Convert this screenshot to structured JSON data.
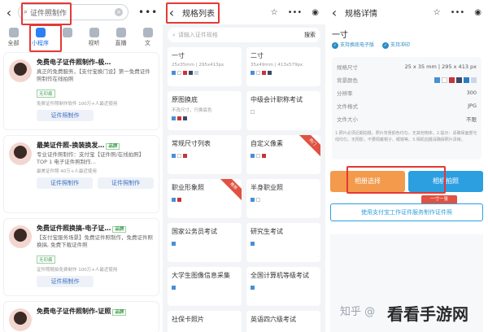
{
  "panel1": {
    "search_value": "证件照制作",
    "more_icon": "more-dots-icon",
    "tabs": [
      {
        "label": "全部",
        "active": false
      },
      {
        "label": "小程序",
        "active": true
      },
      {
        "label": "",
        "active": false
      },
      {
        "label": "视听",
        "active": false
      },
      {
        "label": "直播",
        "active": false
      },
      {
        "label": "文",
        "active": false
      }
    ],
    "results": [
      {
        "title": "免费电子证件照制作-极…",
        "desc": "真正的免费服务，【支付宝换门设】第一免费证件照制作在线拍照",
        "tag": "无印痕",
        "meta": "免费证件照制作软件  100万+人最近使用",
        "btn1": "证件照制作",
        "btn2": ""
      },
      {
        "title": "最美证件照-换装换发…",
        "badge": "品牌",
        "desc": "专业证件照制作：支付宝【证件照/在线拍照】TOP 1 电子证件照制作...",
        "tag": "",
        "meta": "最美证件照  40万+人最近使用",
        "btn1": "证件照制作",
        "btn2": "证件照制作"
      },
      {
        "title": "免费证件照换搞-电子证…",
        "badge": "品牌",
        "desc": "【支付宝服务场景】免费证件照制作，免费证件照换搞, 免费下载证件照",
        "tag": "无印痕",
        "meta": "证件照随拍免费制作  100万+人最近使用",
        "btn1": "证件照制作",
        "btn2": ""
      },
      {
        "title": "免费电子证件照制作-证照",
        "badge": "品牌",
        "desc": "",
        "tag": "",
        "meta": "",
        "btn1": "",
        "btn2": ""
      }
    ]
  },
  "panel2": {
    "title": "规格列表",
    "search_placeholder": "请输入证件规格",
    "search_button": "搜索",
    "specs": [
      {
        "name": "一寸",
        "size": "25x35mm | 295x413px",
        "ribbon": ""
      },
      {
        "name": "二寸",
        "size": "35x49mm | 413x579px",
        "ribbon": ""
      },
      {
        "name": "原图换底",
        "size": "不改尺寸，只换底色",
        "ribbon": ""
      },
      {
        "name": "中级会计职称考试",
        "size": "",
        "ribbon": ""
      },
      {
        "name": "常规尺寸列表",
        "size": "",
        "ribbon": ""
      },
      {
        "name": "自定义像素",
        "size": "",
        "ribbon": "热门"
      },
      {
        "name": "职业形象照",
        "size": "",
        "ribbon": "推荐"
      },
      {
        "name": "半身职业照",
        "size": "",
        "ribbon": ""
      },
      {
        "name": "国家公务员考试",
        "size": "",
        "ribbon": ""
      },
      {
        "name": "研究生考试",
        "size": "",
        "ribbon": ""
      },
      {
        "name": "大学生图像信息采集",
        "size": "",
        "ribbon": ""
      },
      {
        "name": "全国计算机等级考试",
        "size": "",
        "ribbon": ""
      },
      {
        "name": "社保卡照片",
        "size": "",
        "ribbon": ""
      },
      {
        "name": "英语四六级考试",
        "size": "",
        "ribbon": ""
      }
    ]
  },
  "panel3": {
    "title": "规格详情",
    "size_name": "一寸",
    "checks": [
      "支持换底电子版",
      "支持冲印"
    ],
    "rows": [
      {
        "k": "规格尺寸",
        "v": "25 x 35 mm | 295 x 413 px"
      },
      {
        "k": "背景颜色",
        "v": ""
      },
      {
        "k": "分辨率",
        "v": "300"
      },
      {
        "k": "文件格式",
        "v": "JPG"
      },
      {
        "k": "文件大小",
        "v": "不限"
      }
    ],
    "note": "1.照片必须近期拍摄，照片背景颜色均匀，无其他物体。2.提示：请确保面部光线均匀，无阴影，不要佩戴帽子、眼镜等。3.相机拍摄请确保照片清晰。",
    "btn_album": "相册选择",
    "btn_camera": "相机拍照",
    "tip": "一寸一张",
    "link": "使用支付宝工作证件服务制作证件照"
  },
  "watermark": {
    "zhihu": "知乎 @",
    "site": "看看手游网"
  },
  "colors": {
    "accent_blue": "#2c9fe1",
    "orange": "#f39a4c",
    "highlight_red": "#e53935",
    "swatch_blue": "#4a8fd6",
    "swatch_red": "#c6353a",
    "swatch_dark": "#3a4a66",
    "swatch_white": "#ffffff",
    "swatch_light": "#c9d7ea"
  }
}
